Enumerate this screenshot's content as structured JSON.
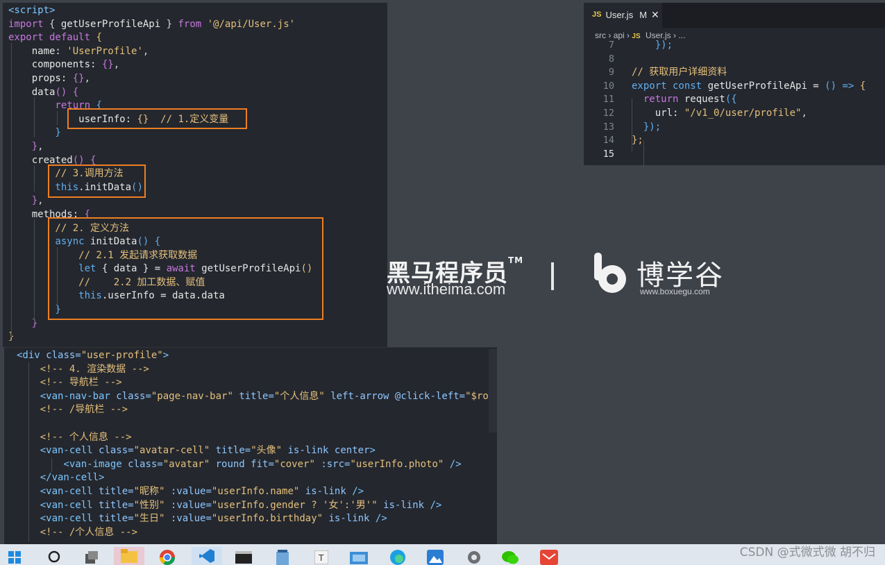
{
  "editor_top_left": {
    "lines": [
      [
        [
          "<script>",
          "tag"
        ]
      ],
      [
        [
          "import ",
          "kw"
        ],
        [
          "{ ",
          "pun"
        ],
        [
          "getUserProfileApi",
          "fn"
        ],
        [
          " } ",
          "pun"
        ],
        [
          "from ",
          "kw"
        ],
        [
          "'@/api/User.js'",
          "str"
        ]
      ],
      [
        [
          "export default ",
          "kw"
        ],
        [
          "{",
          "brk1"
        ]
      ],
      [
        [
          "    name: ",
          "fn"
        ],
        [
          "'UserProfile'",
          "str"
        ],
        [
          ",",
          "pun"
        ]
      ],
      [
        [
          "    components: ",
          "fn"
        ],
        [
          "{}",
          "brk2"
        ],
        [
          ",",
          "pun"
        ]
      ],
      [
        [
          "    props: ",
          "fn"
        ],
        [
          "{}",
          "brk2"
        ],
        [
          ",",
          "pun"
        ]
      ],
      [
        [
          "    data",
          "fn"
        ],
        [
          "() ",
          "brk2"
        ],
        [
          "{",
          "brk2"
        ]
      ],
      [
        [
          "        return ",
          "kw"
        ],
        [
          "{",
          "brk3"
        ]
      ],
      [
        [
          "            userInfo: ",
          "fn"
        ],
        [
          "{}",
          "brk1"
        ],
        [
          "  // 1.定义变量",
          "cmt"
        ]
      ],
      [
        [
          "        }",
          "brk3"
        ]
      ],
      [
        [
          "    }",
          "brk2"
        ],
        [
          ",",
          "pun"
        ]
      ],
      [
        [
          "    created",
          "fn"
        ],
        [
          "() ",
          "brk2"
        ],
        [
          "{",
          "brk2"
        ]
      ],
      [
        [
          "        // 3.调用方法",
          "cmt"
        ]
      ],
      [
        [
          "        this",
          "kw2"
        ],
        [
          ".initData",
          "fn"
        ],
        [
          "()",
          "brk3"
        ]
      ],
      [
        [
          "    }",
          "brk2"
        ],
        [
          ",",
          "pun"
        ]
      ],
      [
        [
          "    methods: ",
          "fn"
        ],
        [
          "{",
          "brk2"
        ]
      ],
      [
        [
          "        // 2. 定义方法",
          "cmt"
        ]
      ],
      [
        [
          "        async ",
          "kw2"
        ],
        [
          "initData",
          "fn"
        ],
        [
          "() ",
          "brk3"
        ],
        [
          "{",
          "brk3"
        ]
      ],
      [
        [
          "            // 2.1 发起请求获取数据",
          "cmt"
        ]
      ],
      [
        [
          "            let ",
          "kw2"
        ],
        [
          "{ data } = ",
          "fn"
        ],
        [
          "await ",
          "kw"
        ],
        [
          "getUserProfileApi",
          "fn"
        ],
        [
          "()",
          "brk1"
        ]
      ],
      [
        [
          "            //    2.2 加工数据、赋值",
          "cmt"
        ]
      ],
      [
        [
          "            this",
          "kw2"
        ],
        [
          ".userInfo = data.data",
          "fn"
        ]
      ],
      [
        [
          "        }",
          "brk3"
        ]
      ],
      [
        [
          "    }",
          "brk2"
        ]
      ],
      [
        [
          "}",
          "brk1"
        ]
      ]
    ]
  },
  "editor_right": {
    "tab_label": "User.js",
    "tab_badge": "JS",
    "tab_modified": "M",
    "tab_close": "✕",
    "breadcrumb": [
      "src",
      "api",
      "JS",
      "User.js",
      "..."
    ],
    "line_numbers": [
      "7",
      "8",
      "9",
      "10",
      "11",
      "12",
      "13",
      "14",
      "15"
    ],
    "lines": [
      [
        [
          "    });",
          "brk3"
        ]
      ],
      [],
      [
        [
          "// 获取用户详细资料",
          "cmt"
        ]
      ],
      [
        [
          "export const ",
          "kw2"
        ],
        [
          "getUserProfileApi = ",
          "fn"
        ],
        [
          "() => ",
          "kw2"
        ],
        [
          "{",
          "brk1"
        ]
      ],
      [
        [
          "  return ",
          "kw"
        ],
        [
          "request",
          "fn"
        ],
        [
          "({",
          "brk3"
        ]
      ],
      [
        [
          "    url: ",
          "fn"
        ],
        [
          "\"/v1_0/user/profile\"",
          "aval"
        ],
        [
          ",",
          "pun"
        ]
      ],
      [
        [
          "  });",
          "brk3"
        ]
      ],
      [
        [
          "};",
          "brk1"
        ]
      ],
      []
    ]
  },
  "editor_bottom": {
    "lines": [
      [
        [
          "<div ",
          "tag"
        ],
        [
          "class=",
          "attr"
        ],
        [
          "\"user-profile\"",
          "aval"
        ],
        [
          ">",
          "tag"
        ]
      ],
      [
        [
          "    <!-- 4. 渲染数据 -->",
          "hcmt"
        ]
      ],
      [
        [
          "    <!-- 导航栏 -->",
          "hcmt"
        ]
      ],
      [
        [
          "    <van-nav-bar ",
          "tag"
        ],
        [
          "class=",
          "attr"
        ],
        [
          "\"page-nav-bar\" ",
          "aval"
        ],
        [
          "title=",
          "attr"
        ],
        [
          "\"个人信息\" ",
          "aval"
        ],
        [
          "left-arrow ",
          "attr"
        ],
        [
          "@click-left=",
          "attr"
        ],
        [
          "\"$router.back()\"",
          "aval"
        ]
      ],
      [
        [
          "    <!-- /导航栏 -->",
          "hcmt"
        ]
      ],
      [],
      [
        [
          "    <!-- 个人信息 -->",
          "hcmt"
        ]
      ],
      [
        [
          "    <van-cell ",
          "tag"
        ],
        [
          "class=",
          "attr"
        ],
        [
          "\"avatar-cell\" ",
          "aval"
        ],
        [
          "title=",
          "attr"
        ],
        [
          "\"头像\" ",
          "aval"
        ],
        [
          "is-link center",
          "attr"
        ],
        [
          ">",
          "tag"
        ]
      ],
      [
        [
          "        <van-image ",
          "tag"
        ],
        [
          "class=",
          "attr"
        ],
        [
          "\"avatar\" ",
          "aval"
        ],
        [
          "round ",
          "attr"
        ],
        [
          "fit=",
          "attr"
        ],
        [
          "\"cover\" ",
          "aval"
        ],
        [
          ":src=",
          "attr"
        ],
        [
          "\"userInfo.photo\" ",
          "aval"
        ],
        [
          "/>",
          "tag"
        ]
      ],
      [
        [
          "    </van-cell>",
          "tag"
        ]
      ],
      [
        [
          "    <van-cell ",
          "tag"
        ],
        [
          "title=",
          "attr"
        ],
        [
          "\"昵称\" ",
          "aval"
        ],
        [
          ":value=",
          "attr"
        ],
        [
          "\"userInfo.name\" ",
          "aval"
        ],
        [
          "is-link ",
          "attr"
        ],
        [
          "/>",
          "tag"
        ]
      ],
      [
        [
          "    <van-cell ",
          "tag"
        ],
        [
          "title=",
          "attr"
        ],
        [
          "\"性别\" ",
          "aval"
        ],
        [
          ":value=",
          "attr"
        ],
        [
          "\"userInfo.gender ? '女':'男'\" ",
          "aval"
        ],
        [
          "is-link ",
          "attr"
        ],
        [
          "/>",
          "tag"
        ]
      ],
      [
        [
          "    <van-cell ",
          "tag"
        ],
        [
          "title=",
          "attr"
        ],
        [
          "\"生日\" ",
          "aval"
        ],
        [
          ":value=",
          "attr"
        ],
        [
          "\"userInfo.birthday\" ",
          "aval"
        ],
        [
          "is-link ",
          "attr"
        ],
        [
          "/>",
          "tag"
        ]
      ],
      [
        [
          "    <!-- /个人信息 -->",
          "hcmt"
        ]
      ]
    ]
  },
  "logos": {
    "heima_name": "黑马程序员",
    "heima_tm": "TM",
    "heima_url": "www.itheima.com",
    "boxuegu_name": "博学谷",
    "boxuegu_url": "www.boxuegu.com"
  },
  "taskbar": {
    "icons": [
      "windows-start-icon",
      "search-icon",
      "task-view-icon",
      "file-explorer-icon",
      "chrome-icon",
      "vscode-icon",
      "terminal-icon",
      "notepad-icon",
      "text-editor-icon",
      "mail-icon",
      "edge-icon",
      "photos-icon",
      "settings-icon",
      "wechat-icon",
      "mail-app-icon"
    ],
    "watermark": "CSDN @式微式微  胡不归"
  },
  "colors": {
    "highlight_box": "#ee7f22",
    "editor_bg": "#24272e",
    "page_bg": "#3e4249"
  }
}
